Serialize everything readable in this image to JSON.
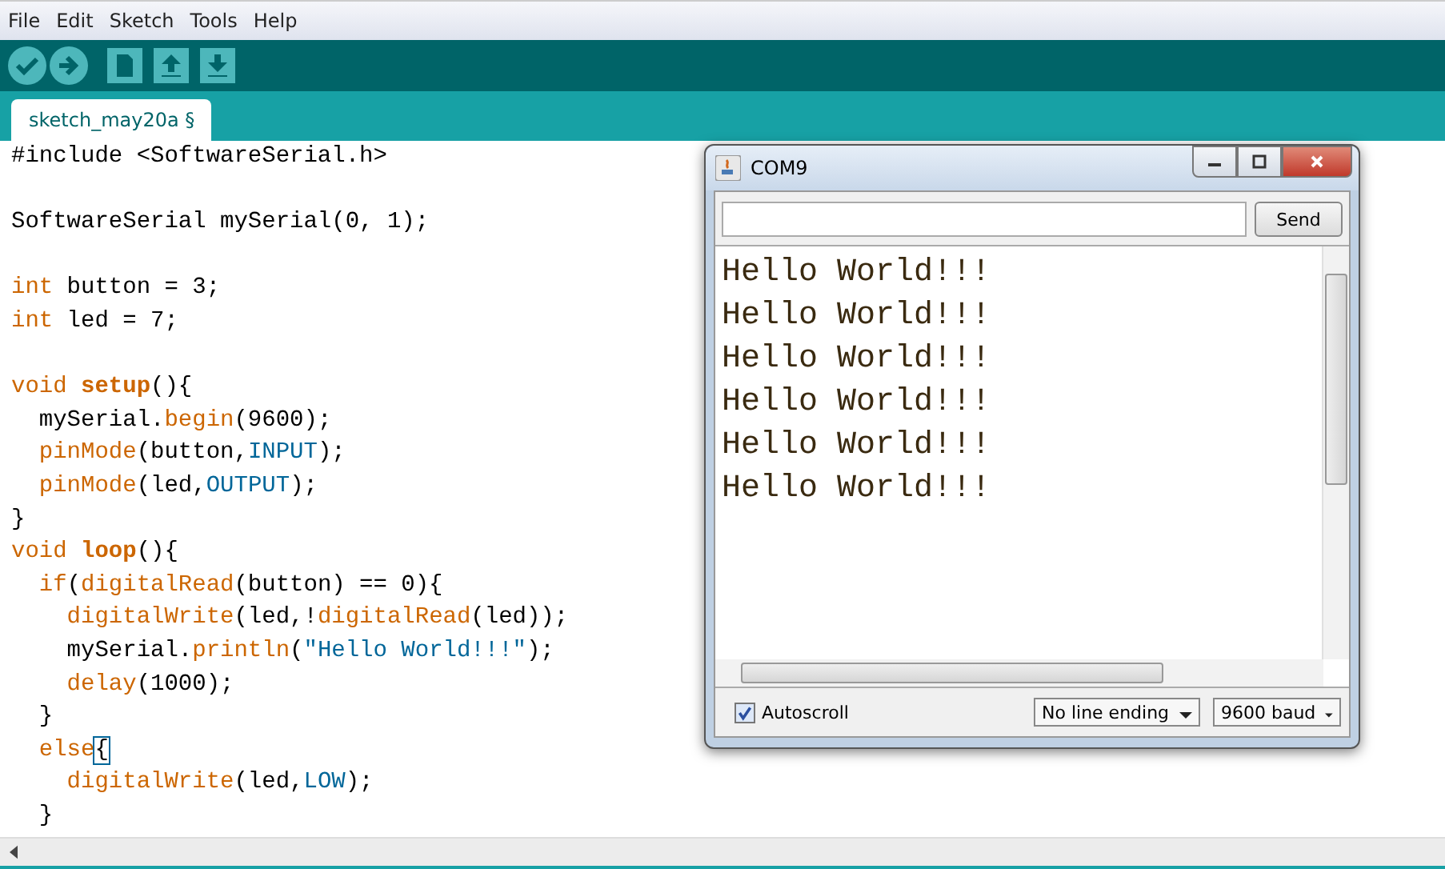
{
  "menu": [
    "File",
    "Edit",
    "Sketch",
    "Tools",
    "Help"
  ],
  "tabs": [
    {
      "label": "sketch_may20a §",
      "selected": true
    }
  ],
  "code_lines": [
    {
      "kind": "code",
      "tokens": [
        {
          "kind": "plain",
          "text": "#include <SoftwareSerial.h>"
        }
      ]
    },
    {
      "kind": "blank"
    },
    {
      "kind": "code",
      "tokens": [
        {
          "kind": "plain",
          "text": "SoftwareSerial mySerial(0, 1);"
        }
      ]
    },
    {
      "kind": "blank"
    },
    {
      "kind": "code",
      "tokens": [
        {
          "kind": "keyword",
          "text": "int"
        },
        {
          "kind": "plain",
          "text": " button = 3;"
        }
      ]
    },
    {
      "kind": "code",
      "tokens": [
        {
          "kind": "keyword",
          "text": "int"
        },
        {
          "kind": "plain",
          "text": " led = 7;"
        }
      ]
    },
    {
      "kind": "blank"
    },
    {
      "kind": "code",
      "tokens": [
        {
          "kind": "keyword",
          "text": "void"
        },
        {
          "kind": "function",
          "text": " setup"
        },
        {
          "kind": "plain",
          "text": "(){"
        }
      ]
    },
    {
      "kind": "code",
      "tokens": [
        {
          "kind": "plain",
          "text": "  mySerial."
        },
        {
          "kind": "keyword",
          "text": "begin"
        },
        {
          "kind": "plain",
          "text": "(9600);"
        }
      ]
    },
    {
      "kind": "code",
      "tokens": [
        {
          "kind": "keyword",
          "text": "  pinMode"
        },
        {
          "kind": "plain",
          "text": "(button,"
        },
        {
          "kind": "constant",
          "text": "INPUT"
        },
        {
          "kind": "plain",
          "text": ");"
        }
      ]
    },
    {
      "kind": "code",
      "tokens": [
        {
          "kind": "keyword",
          "text": "  pinMode"
        },
        {
          "kind": "plain",
          "text": "(led,"
        },
        {
          "kind": "constant",
          "text": "OUTPUT"
        },
        {
          "kind": "plain",
          "text": ");"
        }
      ]
    },
    {
      "kind": "code",
      "tokens": [
        {
          "kind": "plain",
          "text": "}"
        }
      ]
    },
    {
      "kind": "code",
      "tokens": [
        {
          "kind": "keyword",
          "text": "void"
        },
        {
          "kind": "function",
          "text": " loop"
        },
        {
          "kind": "plain",
          "text": "(){"
        }
      ]
    },
    {
      "kind": "code",
      "tokens": [
        {
          "kind": "keyword",
          "text": "  if"
        },
        {
          "kind": "plain",
          "text": "("
        },
        {
          "kind": "keyword",
          "text": "digitalRead"
        },
        {
          "kind": "plain",
          "text": "(button) == 0){"
        }
      ]
    },
    {
      "kind": "code",
      "tokens": [
        {
          "kind": "keyword",
          "text": "    digitalWrite"
        },
        {
          "kind": "plain",
          "text": "(led,!"
        },
        {
          "kind": "keyword",
          "text": "digitalRead"
        },
        {
          "kind": "plain",
          "text": "(led));"
        }
      ]
    },
    {
      "kind": "code",
      "tokens": [
        {
          "kind": "plain",
          "text": "    mySerial."
        },
        {
          "kind": "keyword",
          "text": "println"
        },
        {
          "kind": "plain",
          "text": "("
        },
        {
          "kind": "constant",
          "text": "\"Hello World!!!\""
        },
        {
          "kind": "plain",
          "text": ");"
        }
      ]
    },
    {
      "kind": "code",
      "tokens": [
        {
          "kind": "keyword",
          "text": "    delay"
        },
        {
          "kind": "plain",
          "text": "(1000);"
        }
      ]
    },
    {
      "kind": "code",
      "tokens": [
        {
          "kind": "plain",
          "text": "  }"
        }
      ]
    },
    {
      "kind": "code",
      "tokens": [
        {
          "kind": "keyword",
          "text": "  else"
        },
        {
          "kind": "bracket",
          "text": "{"
        }
      ]
    },
    {
      "kind": "code",
      "tokens": [
        {
          "kind": "keyword",
          "text": "    digitalWrite"
        },
        {
          "kind": "plain",
          "text": "(led,"
        },
        {
          "kind": "constant",
          "text": "LOW"
        },
        {
          "kind": "plain",
          "text": ");"
        }
      ]
    },
    {
      "kind": "code",
      "tokens": [
        {
          "kind": "plain",
          "text": "  }"
        }
      ]
    }
  ],
  "serial_monitor": {
    "title": "COM9",
    "send_button": "Send",
    "output": [
      "Hello World!!!",
      "Hello World!!!",
      "Hello World!!!",
      "Hello World!!!",
      "Hello World!!!",
      "Hello World!!!"
    ],
    "autoscroll": {
      "label": "Autoscroll",
      "checked": true
    },
    "line_ending": "No line ending",
    "baud": "9600 baud"
  }
}
